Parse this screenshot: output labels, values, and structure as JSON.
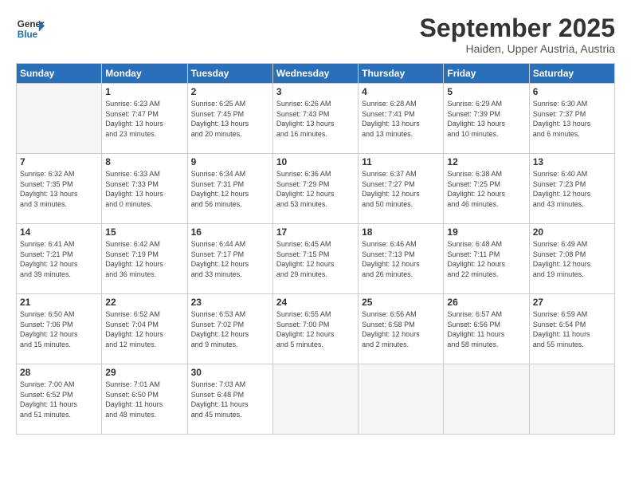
{
  "logo": {
    "line1": "General",
    "line2": "Blue"
  },
  "title": "September 2025",
  "subtitle": "Haiden, Upper Austria, Austria",
  "days_header": [
    "Sunday",
    "Monday",
    "Tuesday",
    "Wednesday",
    "Thursday",
    "Friday",
    "Saturday"
  ],
  "weeks": [
    [
      {
        "day": "",
        "info": ""
      },
      {
        "day": "1",
        "info": "Sunrise: 6:23 AM\nSunset: 7:47 PM\nDaylight: 13 hours\nand 23 minutes."
      },
      {
        "day": "2",
        "info": "Sunrise: 6:25 AM\nSunset: 7:45 PM\nDaylight: 13 hours\nand 20 minutes."
      },
      {
        "day": "3",
        "info": "Sunrise: 6:26 AM\nSunset: 7:43 PM\nDaylight: 13 hours\nand 16 minutes."
      },
      {
        "day": "4",
        "info": "Sunrise: 6:28 AM\nSunset: 7:41 PM\nDaylight: 13 hours\nand 13 minutes."
      },
      {
        "day": "5",
        "info": "Sunrise: 6:29 AM\nSunset: 7:39 PM\nDaylight: 13 hours\nand 10 minutes."
      },
      {
        "day": "6",
        "info": "Sunrise: 6:30 AM\nSunset: 7:37 PM\nDaylight: 13 hours\nand 6 minutes."
      }
    ],
    [
      {
        "day": "7",
        "info": "Sunrise: 6:32 AM\nSunset: 7:35 PM\nDaylight: 13 hours\nand 3 minutes."
      },
      {
        "day": "8",
        "info": "Sunrise: 6:33 AM\nSunset: 7:33 PM\nDaylight: 13 hours\nand 0 minutes."
      },
      {
        "day": "9",
        "info": "Sunrise: 6:34 AM\nSunset: 7:31 PM\nDaylight: 12 hours\nand 56 minutes."
      },
      {
        "day": "10",
        "info": "Sunrise: 6:36 AM\nSunset: 7:29 PM\nDaylight: 12 hours\nand 53 minutes."
      },
      {
        "day": "11",
        "info": "Sunrise: 6:37 AM\nSunset: 7:27 PM\nDaylight: 12 hours\nand 50 minutes."
      },
      {
        "day": "12",
        "info": "Sunrise: 6:38 AM\nSunset: 7:25 PM\nDaylight: 12 hours\nand 46 minutes."
      },
      {
        "day": "13",
        "info": "Sunrise: 6:40 AM\nSunset: 7:23 PM\nDaylight: 12 hours\nand 43 minutes."
      }
    ],
    [
      {
        "day": "14",
        "info": "Sunrise: 6:41 AM\nSunset: 7:21 PM\nDaylight: 12 hours\nand 39 minutes."
      },
      {
        "day": "15",
        "info": "Sunrise: 6:42 AM\nSunset: 7:19 PM\nDaylight: 12 hours\nand 36 minutes."
      },
      {
        "day": "16",
        "info": "Sunrise: 6:44 AM\nSunset: 7:17 PM\nDaylight: 12 hours\nand 33 minutes."
      },
      {
        "day": "17",
        "info": "Sunrise: 6:45 AM\nSunset: 7:15 PM\nDaylight: 12 hours\nand 29 minutes."
      },
      {
        "day": "18",
        "info": "Sunrise: 6:46 AM\nSunset: 7:13 PM\nDaylight: 12 hours\nand 26 minutes."
      },
      {
        "day": "19",
        "info": "Sunrise: 6:48 AM\nSunset: 7:11 PM\nDaylight: 12 hours\nand 22 minutes."
      },
      {
        "day": "20",
        "info": "Sunrise: 6:49 AM\nSunset: 7:08 PM\nDaylight: 12 hours\nand 19 minutes."
      }
    ],
    [
      {
        "day": "21",
        "info": "Sunrise: 6:50 AM\nSunset: 7:06 PM\nDaylight: 12 hours\nand 15 minutes."
      },
      {
        "day": "22",
        "info": "Sunrise: 6:52 AM\nSunset: 7:04 PM\nDaylight: 12 hours\nand 12 minutes."
      },
      {
        "day": "23",
        "info": "Sunrise: 6:53 AM\nSunset: 7:02 PM\nDaylight: 12 hours\nand 9 minutes."
      },
      {
        "day": "24",
        "info": "Sunrise: 6:55 AM\nSunset: 7:00 PM\nDaylight: 12 hours\nand 5 minutes."
      },
      {
        "day": "25",
        "info": "Sunrise: 6:56 AM\nSunset: 6:58 PM\nDaylight: 12 hours\nand 2 minutes."
      },
      {
        "day": "26",
        "info": "Sunrise: 6:57 AM\nSunset: 6:56 PM\nDaylight: 11 hours\nand 58 minutes."
      },
      {
        "day": "27",
        "info": "Sunrise: 6:59 AM\nSunset: 6:54 PM\nDaylight: 11 hours\nand 55 minutes."
      }
    ],
    [
      {
        "day": "28",
        "info": "Sunrise: 7:00 AM\nSunset: 6:52 PM\nDaylight: 11 hours\nand 51 minutes."
      },
      {
        "day": "29",
        "info": "Sunrise: 7:01 AM\nSunset: 6:50 PM\nDaylight: 11 hours\nand 48 minutes."
      },
      {
        "day": "30",
        "info": "Sunrise: 7:03 AM\nSunset: 6:48 PM\nDaylight: 11 hours\nand 45 minutes."
      },
      {
        "day": "",
        "info": ""
      },
      {
        "day": "",
        "info": ""
      },
      {
        "day": "",
        "info": ""
      },
      {
        "day": "",
        "info": ""
      }
    ]
  ]
}
